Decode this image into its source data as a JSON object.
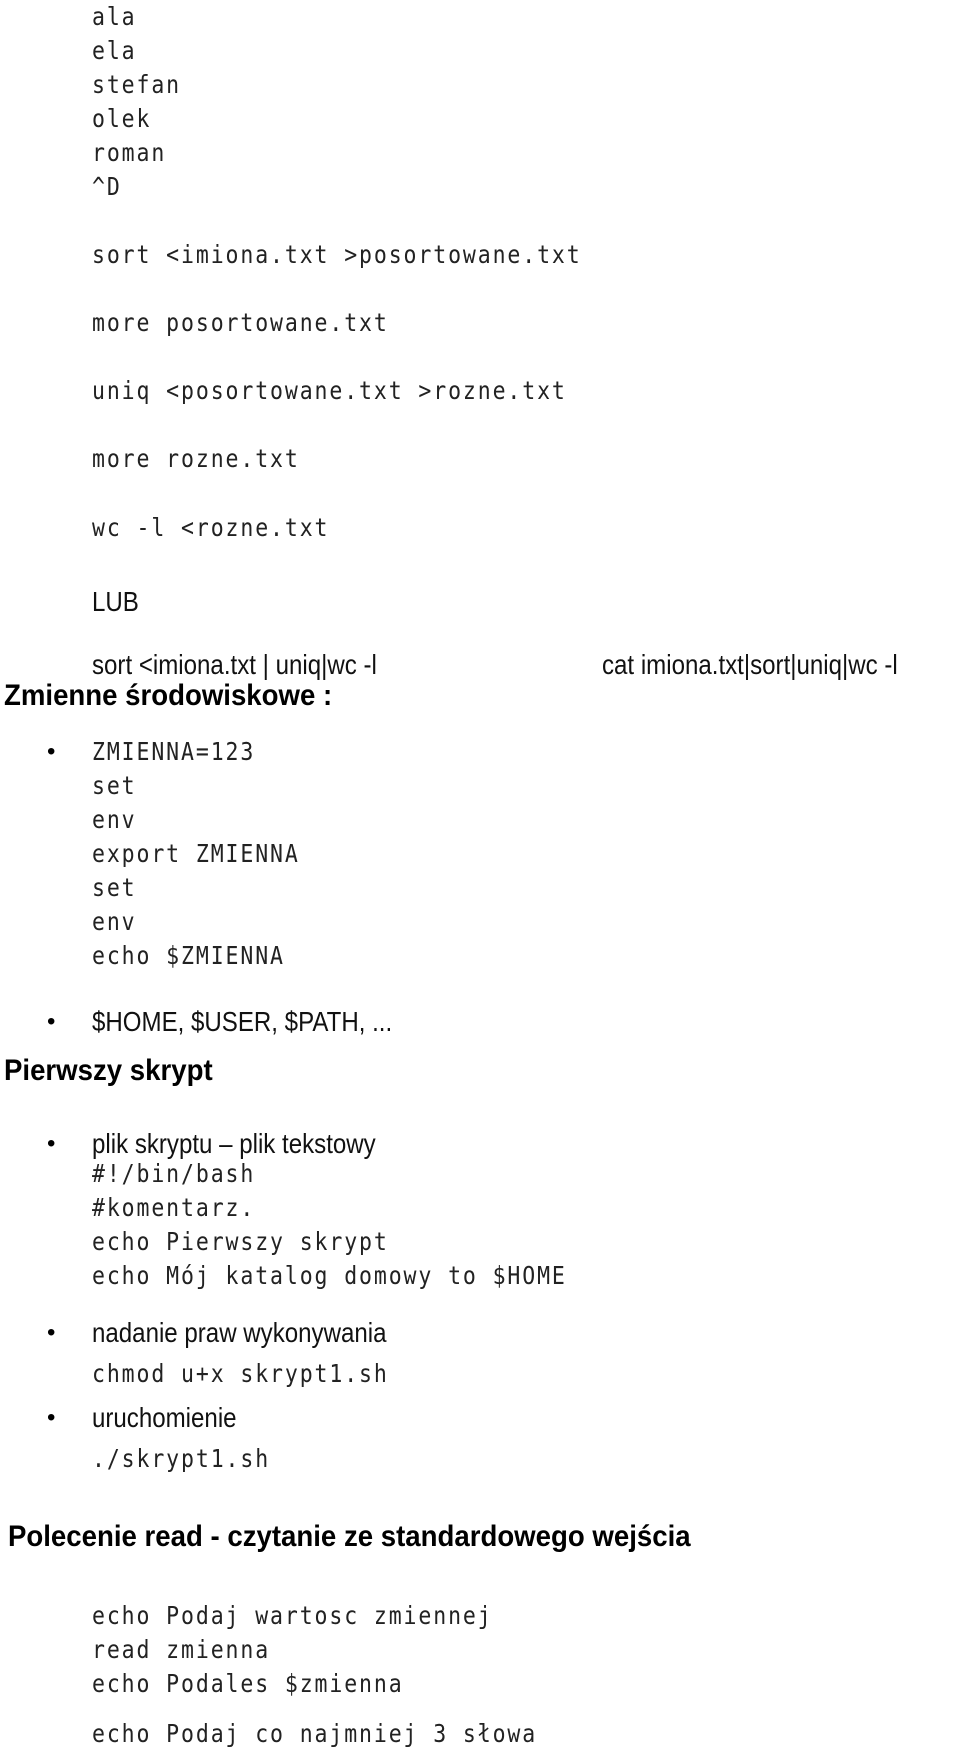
{
  "stdin_lines": [
    "ala",
    "ela",
    "stefan",
    "olek",
    "roman",
    "^D"
  ],
  "commands": [
    "sort <imiona.txt >posortowane.txt",
    "more posortowane.txt",
    "uniq <posortowane.txt >rozne.txt",
    "more rozne.txt",
    "wc -l <rozne.txt"
  ],
  "alternative_label": "LUB",
  "pipeline_1": "sort <imiona.txt | uniq|wc -l",
  "pipeline_2": "cat imiona.txt|sort|uniq|wc -l",
  "section_env": {
    "heading": "Zmienne środowiskowe :",
    "code_lines": [
      "ZMIENNA=123",
      "set",
      "env",
      "export ZMIENNA",
      "set",
      "env",
      "echo $ZMIENNA"
    ],
    "vars_bullet": "$HOME, $USER, $PATH, ..."
  },
  "section_script": {
    "heading": "Pierwszy skrypt",
    "bullet_1": "plik skryptu – plik tekstowy",
    "script_lines": [
      "#!/bin/bash",
      "#komentarz.",
      "echo Pierwszy skrypt",
      "echo Mój katalog domowy to $HOME"
    ],
    "bullet_2": "nadanie praw wykonywania",
    "chmod_cmd": "chmod u+x skrypt1.sh",
    "bullet_3": "uruchomienie",
    "run_cmd": "./skrypt1.sh"
  },
  "section_read": {
    "heading": "Polecenie read - czytanie ze standardowego wejścia",
    "code_lines": [
      "echo Podaj wartosc zmiennej",
      "read zmienna",
      "echo Podales $zmienna"
    ],
    "last_line": "echo Podaj co najmniej 3 słowa"
  },
  "bullet_glyph": "•"
}
